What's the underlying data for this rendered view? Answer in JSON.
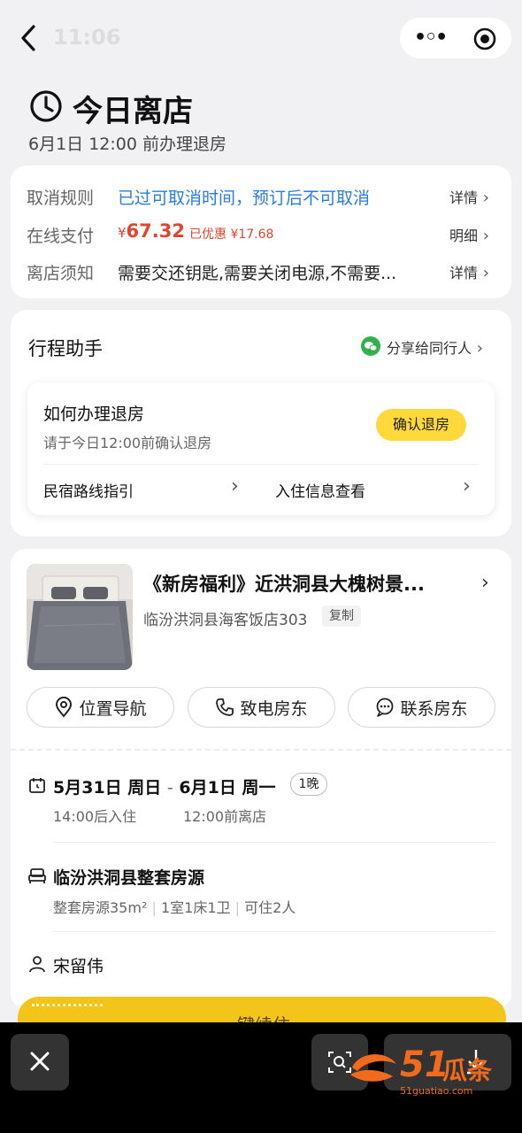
{
  "status_bar": {
    "time": "11:06"
  },
  "header": {
    "title": "今日离店",
    "subtitle": "6月1日 12:00 前办理退房"
  },
  "rules": {
    "cancel": {
      "label": "取消规则",
      "value": "已过可取消时间，预订后不可取消",
      "link": "详情"
    },
    "payment": {
      "label": "在线支付",
      "currency": "¥",
      "amount": "67.32",
      "discount": "已优惠 ¥17.68",
      "link": "明细"
    },
    "notice": {
      "label": "离店须知",
      "value": "需要交还钥匙,需要关闭电源,不需要...",
      "link": "详情"
    }
  },
  "assistant": {
    "title": "行程助手",
    "share": "分享给同行人",
    "checkout_title": "如何办理退房",
    "checkout_desc": "请于今日12:00前确认退房",
    "checkout_button": "确认退房",
    "route_link": "民宿路线指引",
    "checkin_info_link": "入住信息查看"
  },
  "stay": {
    "property_name": "《新房福利》近洪洞县大槐树景...",
    "address": "临汾洪洞县海客饭店303",
    "copy": "复制",
    "actions": {
      "navigate": "位置导航",
      "call": "致电房东",
      "contact": "联系房东"
    },
    "dates": {
      "checkin_date": "5月31日 周日",
      "sep": "-",
      "checkout_date": "6月1日 周一",
      "nights": "1晚",
      "checkin_time": "14:00后入住",
      "checkout_time": "12:00前离店"
    },
    "room": {
      "name": "临汾洪洞县整套房源",
      "type": "整套房源35m²",
      "layout": "1室1床1卫",
      "capacity": "可住2人"
    },
    "guest": "宋留伟"
  },
  "bottom": {
    "partial_button": "键续住"
  },
  "watermark": {
    "num": "51",
    "cn": "瓜条",
    "url": "51guatiao.com"
  },
  "colors": {
    "accent_yellow": "#ffd93a",
    "price_red": "#e0452f",
    "link_blue": "#2a7de0",
    "wechat_green": "#2fb24a"
  }
}
